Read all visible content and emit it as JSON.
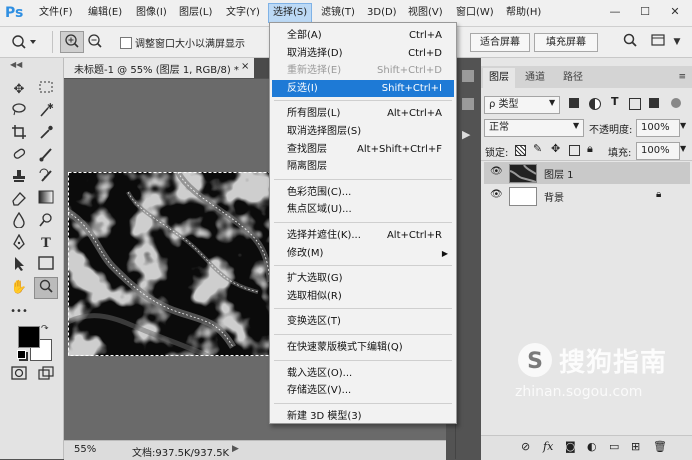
{
  "app": {
    "logo": "Ps"
  },
  "menubar": {
    "items": [
      "文件(F)",
      "编辑(E)",
      "图像(I)",
      "图层(L)",
      "文字(Y)",
      "选择(S)",
      "滤镜(T)",
      "3D(D)",
      "视图(V)",
      "窗口(W)",
      "帮助(H)"
    ],
    "active_index": 5,
    "window_controls": [
      "—",
      "☐",
      "✕"
    ]
  },
  "options_bar": {
    "tool_icon": "zoom-tool-icon",
    "checkbox_label": "调整窗口大小以满屏显示",
    "fit_screen": "适合屏幕",
    "fill_screen": "填充屏幕"
  },
  "document": {
    "tab_title": "未标题-1 @ 55% (图层 1, RGB/8) *",
    "tab_close": "×",
    "zoom": "55%",
    "doc_info": "文档:937.5K/937.5K"
  },
  "select_menu": {
    "groups": [
      [
        {
          "label": "全部(A)",
          "shortcut": "Ctrl+A",
          "state": "normal"
        },
        {
          "label": "取消选择(D)",
          "shortcut": "Ctrl+D",
          "state": "normal"
        },
        {
          "label": "重新选择(E)",
          "shortcut": "Shift+Ctrl+D",
          "state": "disabled"
        },
        {
          "label": "反选(I)",
          "shortcut": "Shift+Ctrl+I",
          "state": "highlighted"
        }
      ],
      [
        {
          "label": "所有图层(L)",
          "shortcut": "Alt+Ctrl+A",
          "state": "normal"
        },
        {
          "label": "取消选择图层(S)",
          "shortcut": "",
          "state": "normal"
        },
        {
          "label": "查找图层",
          "shortcut": "Alt+Shift+Ctrl+F",
          "state": "normal"
        },
        {
          "label": "隔离图层",
          "shortcut": "",
          "state": "normal"
        }
      ],
      [
        {
          "label": "色彩范围(C)...",
          "shortcut": "",
          "state": "normal"
        },
        {
          "label": "焦点区域(U)...",
          "shortcut": "",
          "state": "normal"
        }
      ],
      [
        {
          "label": "选择并遮住(K)...",
          "shortcut": "Alt+Ctrl+R",
          "state": "normal"
        },
        {
          "label": "修改(M)",
          "shortcut": "",
          "state": "submenu"
        }
      ],
      [
        {
          "label": "扩大选取(G)",
          "shortcut": "",
          "state": "normal"
        },
        {
          "label": "选取相似(R)",
          "shortcut": "",
          "state": "normal"
        }
      ],
      [
        {
          "label": "变换选区(T)",
          "shortcut": "",
          "state": "normal"
        }
      ],
      [
        {
          "label": "在快速蒙版模式下编辑(Q)",
          "shortcut": "",
          "state": "normal"
        }
      ],
      [
        {
          "label": "载入选区(O)...",
          "shortcut": "",
          "state": "normal"
        },
        {
          "label": "存储选区(V)...",
          "shortcut": "",
          "state": "normal"
        }
      ],
      [
        {
          "label": "新建 3D 模型(3)",
          "shortcut": "",
          "state": "normal"
        }
      ]
    ]
  },
  "layers_panel": {
    "tabs": [
      "图层",
      "通道",
      "路径"
    ],
    "active_tab": 0,
    "filter_kind": "ρ 类型",
    "blend_mode": "正常",
    "opacity_label": "不透明度:",
    "opacity": "100%",
    "lock_label": "锁定:",
    "fill_label": "填充:",
    "fill": "100%",
    "layers": [
      {
        "name": "图层 1",
        "selected": true,
        "locked": false
      },
      {
        "name": "背景",
        "selected": false,
        "locked": true
      }
    ]
  },
  "watermark": {
    "brand": "搜狗指南",
    "url": "zhinan.sogou.com"
  }
}
